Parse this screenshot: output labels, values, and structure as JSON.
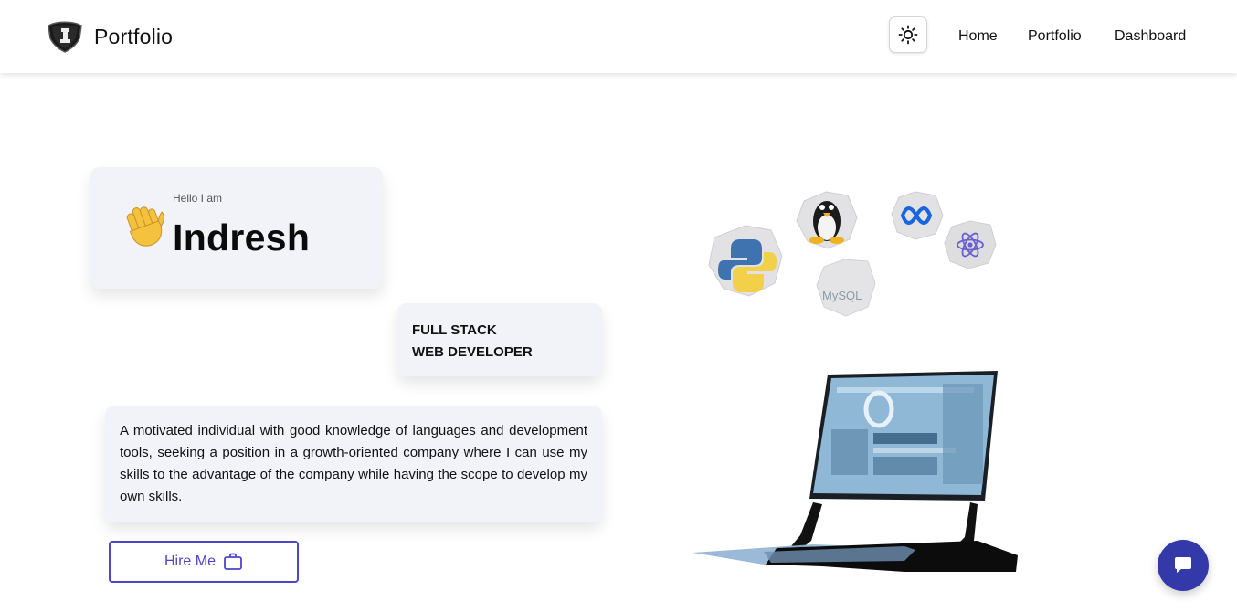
{
  "header": {
    "brand_title": "Portfolio",
    "logo_icon": "shield-logo-icon",
    "theme_toggle_icon": "sun-icon",
    "nav": [
      {
        "label": "Home"
      },
      {
        "label": "Portfolio"
      },
      {
        "label": "Dashboard"
      }
    ]
  },
  "hero": {
    "greeting": "Hello I am",
    "name": "Indresh",
    "wave_icon": "waving-hand-icon",
    "role_lines": [
      "FULL STACK",
      "WEB DEVELOPER"
    ],
    "about": "A motivated individual with good knowledge of languages and development tools, seeking a position in a growth-oriented company where I can use my skills to the advantage of the company while having the scope to develop my own skills.",
    "hire_button": {
      "label": "Hire Me",
      "icon": "briefcase-icon"
    }
  },
  "illustration": {
    "tech_icons": [
      "python-icon",
      "linux-icon",
      "mysql-icon",
      "meta-icon",
      "react-icon"
    ],
    "mysql_label": "MySQL",
    "laptop": "laptop-illustration"
  },
  "chat": {
    "icon": "chat-bubble-icon"
  },
  "colors": {
    "accent": "#4d46c9",
    "card_bg": "#f1f3f8",
    "chat_bg": "#3339a8"
  }
}
